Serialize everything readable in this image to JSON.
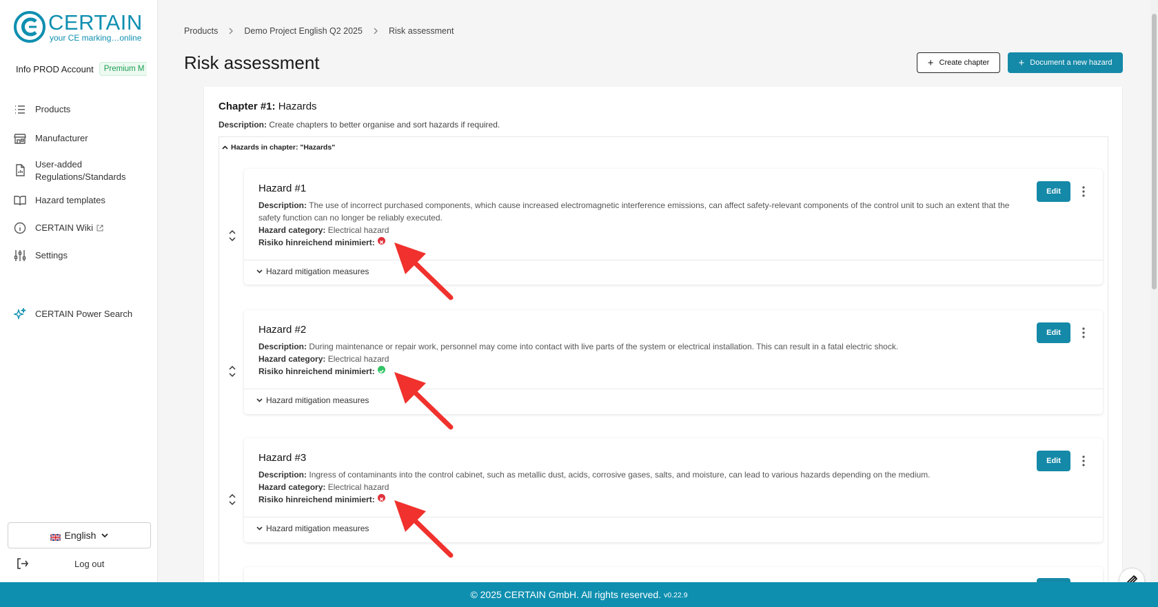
{
  "brand": {
    "name": "CERTAIN",
    "tagline": "your CE marking…online",
    "accent_color": "#0f8fb0"
  },
  "account": {
    "name": "Info PROD Account",
    "badge": "Premium M"
  },
  "sidebar": {
    "items": [
      {
        "label": "Products",
        "icon": "list-icon"
      },
      {
        "label": "Manufacturer",
        "icon": "store-icon"
      },
      {
        "label": "User-added Regulations/Standards",
        "icon": "document-icon"
      },
      {
        "label": "Hazard templates",
        "icon": "book-icon"
      },
      {
        "label": "CERTAIN Wiki",
        "icon": "info-icon"
      },
      {
        "label": "Settings",
        "icon": "sliders-icon"
      },
      {
        "label": "CERTAIN Power Search",
        "icon": "sparkle-icon"
      }
    ],
    "language": "English",
    "logout": "Log out"
  },
  "breadcrumb": [
    "Products",
    "Demo Project English Q2 2025",
    "Risk assessment"
  ],
  "page": {
    "title": "Risk assessment",
    "create_chapter": "Create chapter",
    "document_hazard": "Document a new hazard"
  },
  "chapter": {
    "label": "Chapter #1:",
    "name": "Hazards",
    "desc_label": "Description:",
    "desc": "Create chapters to better organise and sort hazards if required.",
    "toggle": "Hazards in chapter: \"Hazards\""
  },
  "hazard_labels": {
    "description": "Description:",
    "category": "Hazard category:",
    "minimized": "Risiko hinreichend minimiert:",
    "mitigation": "Hazard mitigation measures",
    "edit": "Edit"
  },
  "hazards": [
    {
      "title": "Hazard #1",
      "description": "The use of incorrect purchased components, which cause increased electromagnetic interference emissions, can affect safety-relevant components of the control unit to such an extent that the safety function can no longer be reliably executed.",
      "category": "Electrical hazard",
      "minimized": false
    },
    {
      "title": "Hazard #2",
      "description": "During maintenance or repair work, personnel may come into contact with live parts of the system or electrical installation. This can result in a fatal electric shock.",
      "category": "Electrical hazard",
      "minimized": true
    },
    {
      "title": "Hazard #3",
      "description": "Ingress of contaminants into the control cabinet, such as metallic dust, acids, corrosive gases, salts, and moisture, can lead to various hazards depending on the medium.",
      "category": "Electrical hazard",
      "minimized": false
    }
  ],
  "footer": {
    "text": "© 2025 CERTAIN GmbH. All rights reserved.",
    "version": "v0.22.9"
  }
}
